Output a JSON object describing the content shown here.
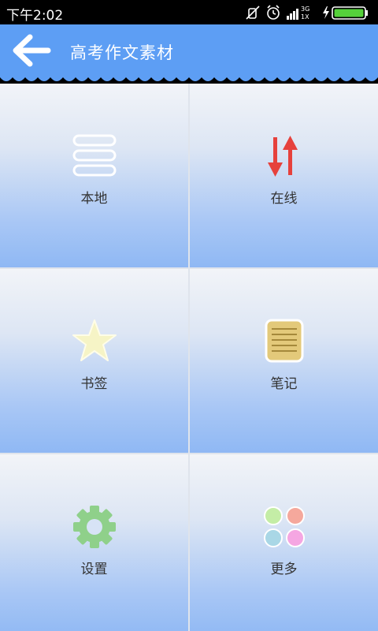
{
  "status_bar": {
    "time": "下午2:02",
    "network": "3G 1X",
    "icons": [
      "mute-icon",
      "alarm-icon",
      "signal-icon",
      "charging-icon",
      "battery-icon"
    ]
  },
  "app_bar": {
    "title": "高考作文素材",
    "back_icon": "arrow-left-icon",
    "color": "#5d9ef4"
  },
  "menu": {
    "items": [
      {
        "label": "本地",
        "icon": "list-icon"
      },
      {
        "label": "在线",
        "icon": "up-down-arrows-icon"
      },
      {
        "label": "书签",
        "icon": "star-icon"
      },
      {
        "label": "笔记",
        "icon": "notepad-icon"
      },
      {
        "label": "设置",
        "icon": "gear-icon"
      },
      {
        "label": "更多",
        "icon": "four-dots-icon"
      }
    ]
  }
}
